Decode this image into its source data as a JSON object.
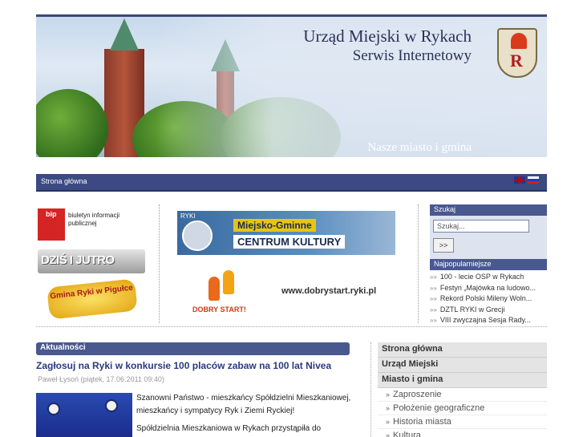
{
  "banner": {
    "title": "Urząd Miejski w Rykach",
    "subtitle": "Serwis Internetowy",
    "motto": "Nasze miasto i gmina"
  },
  "navbar": {
    "home": "Strona główna"
  },
  "left_logos": {
    "bip_mark": "bip",
    "bip_text": "biuletyn informacji publicznej",
    "dzis_label": "DZIŚ I JUTRO",
    "gmina_label": "Gmina Ryki w Pigułce"
  },
  "center_ads": {
    "mgck_small": "RYKI",
    "mgck_line1": "Miejsko-Gminne",
    "mgck_line2": "CENTRUM KULTURY",
    "dobry_start_label": "DOBRY START!",
    "dobry_start_url": "www.dobrystart.ryki.pl"
  },
  "search": {
    "header": "Szukaj",
    "placeholder": "Szukaj...",
    "button": ">>"
  },
  "popular": {
    "header": "Najpopularniejsze",
    "items": [
      "100 - lecie OSP w Rykach",
      "Festyn „Majówka na ludowo...",
      "Rekord Polski Mileny Woln...",
      "DZTL RYKI w Grecji",
      "VIII zwyczajna Sesja Rady..."
    ]
  },
  "news": {
    "header": "Aktualności",
    "title": "Zagłosuj na Ryki w konkursie 100 placów zabaw na 100 lat Nivea",
    "meta": "Paweł Łysoń (piątek, 17.06.2011 09:40)",
    "para1": "Szanowni Państwo - mieszkańcy Spółdzielni Mieszkaniowej, mieszkańcy i sympatycy Ryk i Ziemi Ryckiej!",
    "para2": "Spółdzielnia Mieszkaniowa w Rykach przystąpiła do"
  },
  "menu": {
    "home": "Strona główna",
    "office": "Urząd Miejski",
    "city": "Miasto i gmina",
    "items": [
      "Zaproszenie",
      "Położenie geograficzne",
      "Historia miasta",
      "Kultura"
    ]
  },
  "colors": {
    "navy": "#3b4a82",
    "header_blue": "#4a5890",
    "link_blue": "#2a3a80"
  }
}
